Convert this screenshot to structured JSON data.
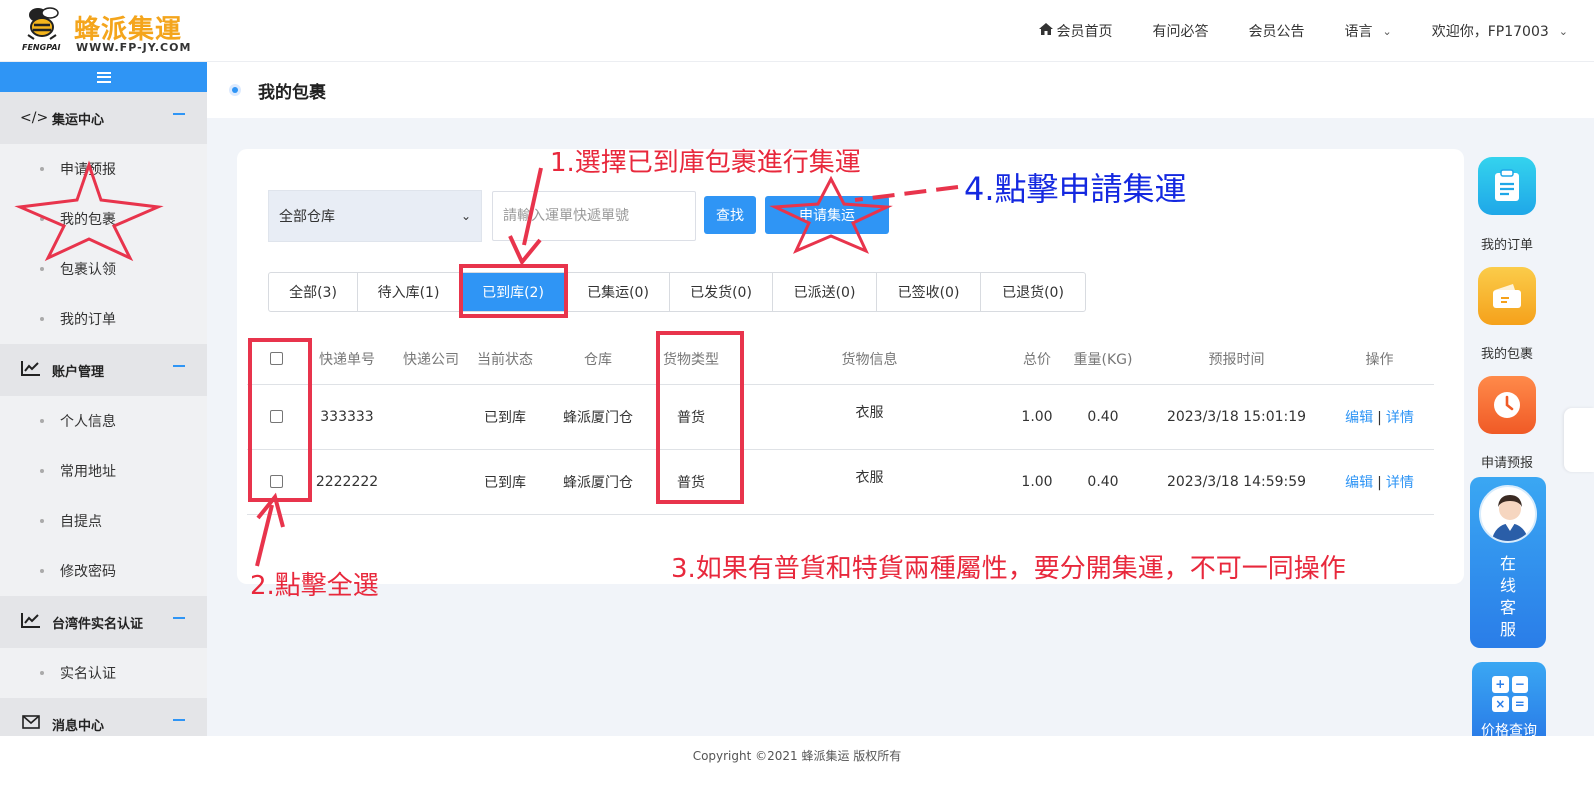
{
  "brand": {
    "name_cn": "蜂派集運",
    "url": "WWW.FP-JY.COM",
    "sub": "FENGPAI"
  },
  "topnav": {
    "home": "会员首页",
    "faq": "有问必答",
    "notice": "会员公告",
    "language": "语言",
    "welcome": "欢迎你，FP17003"
  },
  "sidebar": {
    "groups": [
      {
        "label": "集运中心",
        "icon": "code-icon",
        "items": [
          "申请预报",
          "我的包裹",
          "包裹认领",
          "我的订单"
        ]
      },
      {
        "label": "账户管理",
        "icon": "chart-icon",
        "items": [
          "个人信息",
          "常用地址",
          "自提点",
          "修改密码"
        ]
      },
      {
        "label": "台湾件实名认证",
        "icon": "chart-icon",
        "items": [
          "实名认证"
        ]
      },
      {
        "label": "消息中心",
        "icon": "mail-icon",
        "items": []
      }
    ]
  },
  "page": {
    "title": "我的包裹"
  },
  "filters": {
    "warehouse_selected": "全部仓库",
    "search_placeholder": "請輸入運單快遞單號",
    "find_button": "查找",
    "apply_button": "申请集运"
  },
  "tabs": [
    {
      "label": "全部(3)",
      "active": false
    },
    {
      "label": "待入库(1)",
      "active": false
    },
    {
      "label": "已到库(2)",
      "active": true
    },
    {
      "label": "已集运(0)",
      "active": false
    },
    {
      "label": "已发货(0)",
      "active": false
    },
    {
      "label": "已派送(0)",
      "active": false
    },
    {
      "label": "已签收(0)",
      "active": false
    },
    {
      "label": "已退货(0)",
      "active": false
    }
  ],
  "table": {
    "columns": [
      "快递单号",
      "快递公司",
      "当前状态",
      "仓库",
      "货物类型",
      "货物信息",
      "总价",
      "重量(KG)",
      "预报时间",
      "操作"
    ],
    "rows": [
      {
        "tracking": "333333",
        "company": "",
        "status": "已到库",
        "warehouse": "蜂派厦门仓",
        "type": "普货",
        "info": "衣服",
        "total": "1.00",
        "weight": "0.40",
        "time": "2023/3/18 15:01:19",
        "edit": "编辑",
        "sep": "|",
        "detail": "详情"
      },
      {
        "tracking": "2222222",
        "company": "",
        "status": "已到库",
        "warehouse": "蜂派厦门仓",
        "type": "普货",
        "info": "衣服",
        "total": "1.00",
        "weight": "0.40",
        "time": "2023/3/18 14:59:59",
        "edit": "编辑",
        "sep": "|",
        "detail": "详情"
      }
    ]
  },
  "float_panel": {
    "orders": "我的订单",
    "packages": "我的包裹",
    "forecast": "申请预报",
    "service": "在线客服",
    "price": "价格查询"
  },
  "footer": {
    "copyright": "Copyright ©2021 蜂派集运 版权所有"
  },
  "annotations": {
    "step1": "1.選擇已到庫包裹進行集運",
    "step2": "2.點擊全選",
    "step3": "3.如果有普貨和特貨兩種屬性，要分開集運，不可一同操作",
    "step4": "4.點擊申請集運"
  },
  "colors": {
    "primary": "#2f95f5",
    "brand_orange": "#f4a51c",
    "annotation_red": "#e8283c",
    "annotation_blue": "#1428e0"
  }
}
